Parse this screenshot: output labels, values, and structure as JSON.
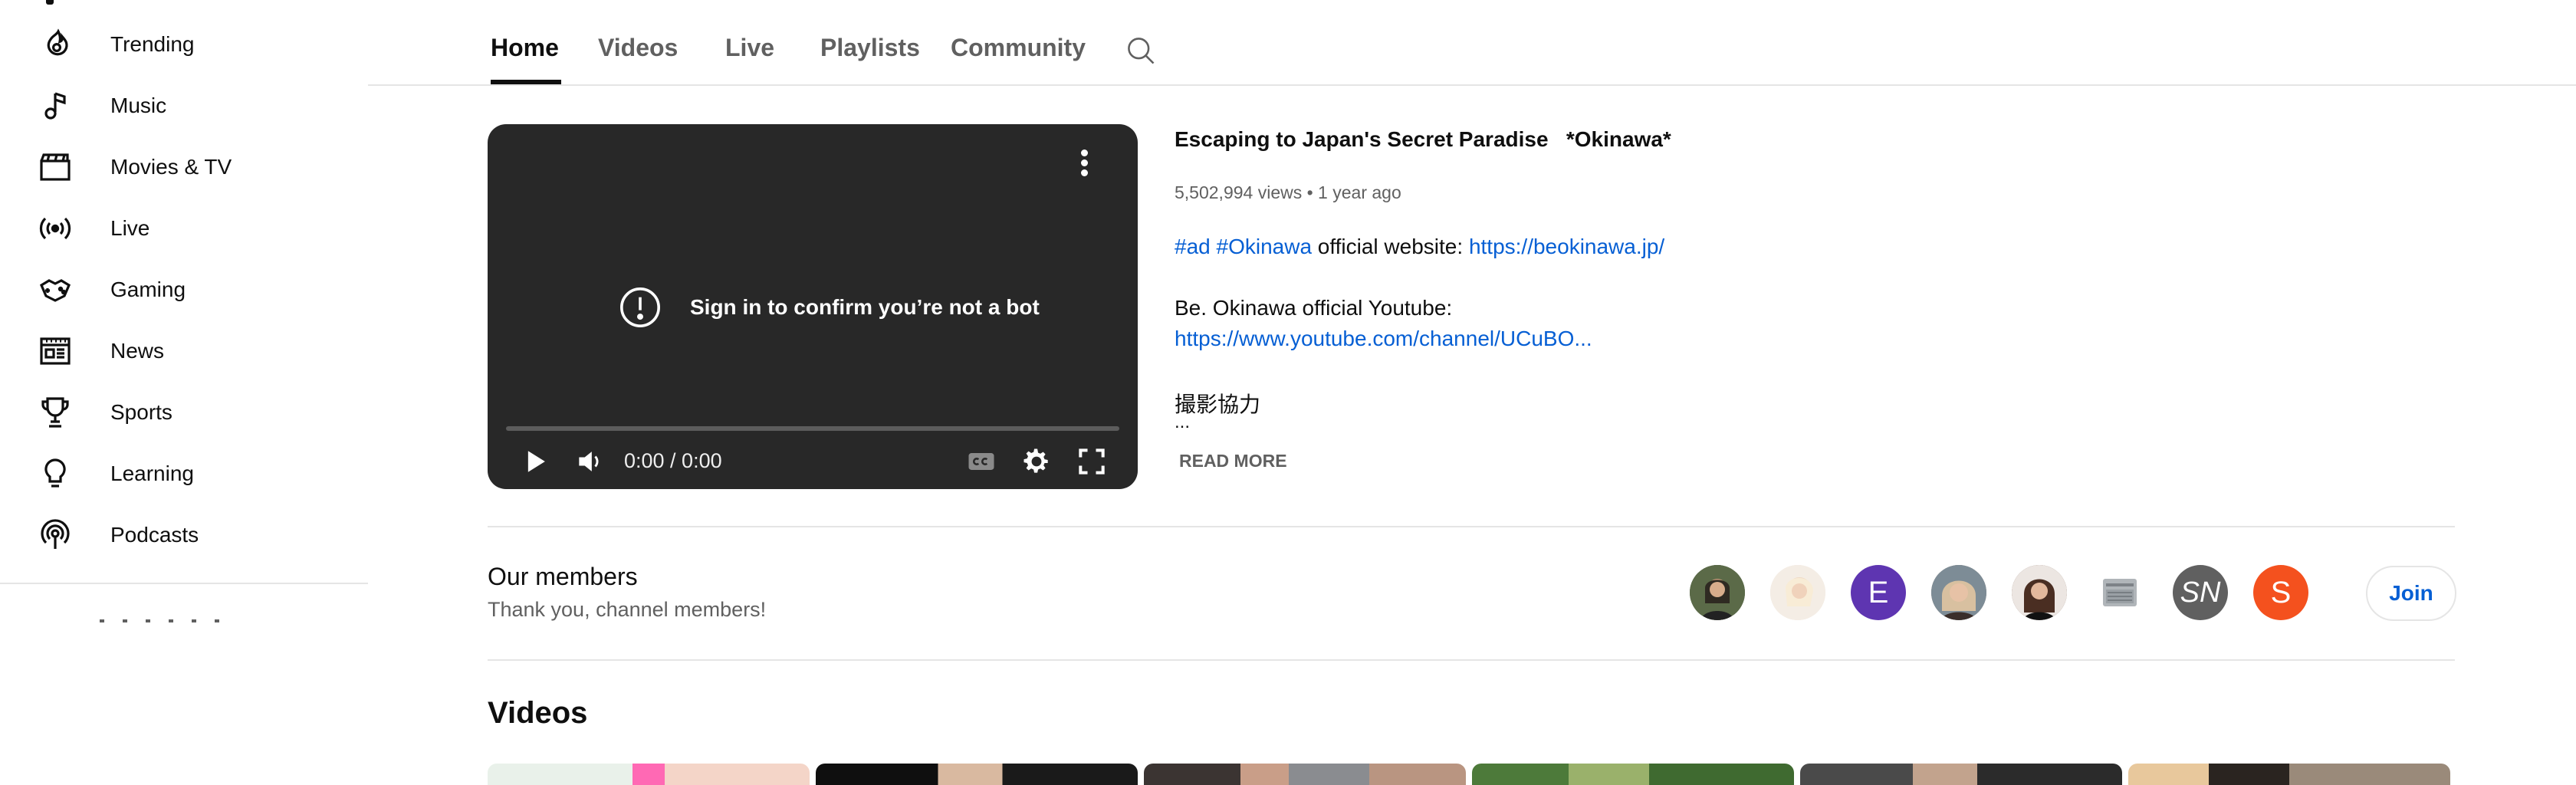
{
  "sidebar": {
    "items": [
      {
        "label": "Trending",
        "icon": "trending-icon"
      },
      {
        "label": "Music",
        "icon": "music-note-icon"
      },
      {
        "label": "Movies & TV",
        "icon": "clapperboard-icon"
      },
      {
        "label": "Live",
        "icon": "live-broadcast-icon"
      },
      {
        "label": "Gaming",
        "icon": "game-controller-icon"
      },
      {
        "label": "News",
        "icon": "newspaper-icon"
      },
      {
        "label": "Sports",
        "icon": "trophy-icon"
      },
      {
        "label": "Learning",
        "icon": "lightbulb-icon"
      },
      {
        "label": "Podcasts",
        "icon": "podcast-icon"
      }
    ]
  },
  "tabs": {
    "items": [
      "Home",
      "Videos",
      "Live",
      "Playlists",
      "Community"
    ],
    "active": "Home",
    "search_icon": "search-icon"
  },
  "player": {
    "message": "Sign in to confirm you’re not a bot",
    "time": "0:00 / 0:00",
    "progress": 0
  },
  "video": {
    "title": "Escaping to Japan's Secret Paradise   *Okinawa*",
    "meta": "5,502,994 views • 1 year ago",
    "hashtag1": "#ad",
    "hashtag2": "#Okinawa",
    "desc_text1": " official website: ",
    "link1": "https://beokinawa.jp/",
    "desc_line2": "Be. Okinawa official Youtube:",
    "link2": "https://www.youtube.com/channel/UCuBO...",
    "desc_line4": "撮影協力",
    "ellipsis": "...",
    "read_more": "READ MORE"
  },
  "members": {
    "title": "Our members",
    "subtitle": "Thank you, channel members!",
    "avatars": [
      {
        "initial": "",
        "color": "#5a6b4a"
      },
      {
        "initial": "",
        "color": "#efe6dc"
      },
      {
        "initial": "E",
        "color": "#5e35b1"
      },
      {
        "initial": "",
        "color": "#8a7a6a"
      },
      {
        "initial": "",
        "color": "#6b4a3a"
      },
      {
        "initial": "",
        "color": "#ffffff"
      },
      {
        "initial": "SN",
        "color": "#606060"
      },
      {
        "initial": "S",
        "color": "#f4511e"
      }
    ],
    "join_label": "Join"
  },
  "videos_section": {
    "heading": "Videos"
  },
  "colors": {
    "link": "#065fd4",
    "player_bg": "#282828",
    "secondary_text": "#606060"
  }
}
